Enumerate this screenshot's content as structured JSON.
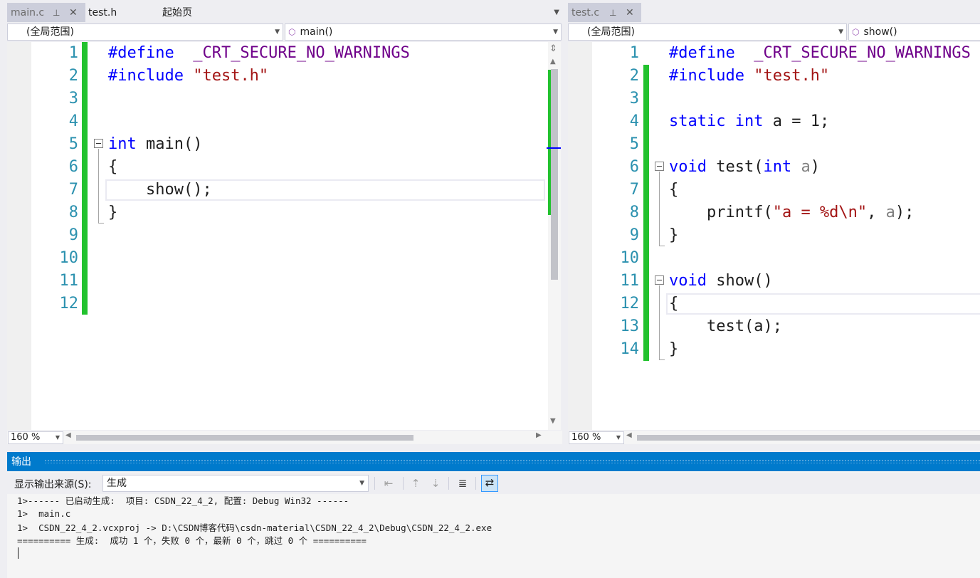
{
  "left_pane": {
    "tabs": [
      {
        "label": "main.c",
        "pin": "⊥",
        "close": "✕"
      },
      {
        "label": "test.h"
      },
      {
        "label": "起始页"
      }
    ],
    "scope": "(全局范围)",
    "function": "main()",
    "zoom": "160 %",
    "lines": [
      "1",
      "2",
      "3",
      "4",
      "5",
      "6",
      "7",
      "8",
      "9",
      "10",
      "11",
      "12"
    ],
    "code": {
      "l1_kw": "#define",
      "l1_macro": "  _CRT_SECURE_NO_WARNINGS",
      "l2_kw": "#include",
      "l2_str": " \"test.h\"",
      "l5_kw": "int",
      "l5_rest": " main()",
      "l6": "{",
      "l7": "    show();",
      "l8": "}"
    }
  },
  "right_pane": {
    "tab": {
      "label": "test.c",
      "pin": "⊥",
      "close": "✕"
    },
    "scope": "(全局范围)",
    "function": "show()",
    "zoom": "160 %",
    "lines": [
      "1",
      "2",
      "3",
      "4",
      "5",
      "6",
      "7",
      "8",
      "9",
      "10",
      "11",
      "12",
      "13",
      "14"
    ],
    "code": {
      "l1_kw": "#define",
      "l1_macro": "  _CRT_SECURE_NO_WARNINGS",
      "l2_kw": "#include",
      "l2_str": " \"test.h\"",
      "l4_kw1": "static",
      "l4_kw2": "int",
      "l4_rest": " a = 1;",
      "l6_kw": "void",
      "l6_mid": " test(",
      "l6_kw2": "int",
      "l6_sp": " ",
      "l6_prm": "a",
      "l6_end": ")",
      "l7": "{",
      "l8_a": "    printf(",
      "l8_str": "\"a = %d\\n\"",
      "l8_b": ", ",
      "l8_prm": "a",
      "l8_c": ");",
      "l9": "}",
      "l11_kw": "void",
      "l11_rest": " show()",
      "l12": "{",
      "l13": "    test(a);",
      "l14": "}"
    }
  },
  "output": {
    "title": "输出",
    "source_label": "显示输出来源(S):",
    "source_value": "生成",
    "lines": [
      "1>------ 已启动生成:  项目: CSDN_22_4_2, 配置: Debug Win32 ------",
      "1>  main.c",
      "1>  CSDN_22_4_2.vcxproj -> D:\\CSDN博客代码\\csdn-material\\CSDN_22_4_2\\Debug\\CSDN_22_4_2.exe",
      "========== 生成:  成功 1 个，失败 0 个，最新 0 个，跳过 0 个 =========="
    ]
  },
  "colors": {
    "accent": "#007acc",
    "change_bar": "#22c22e",
    "keyword": "#0000ff",
    "string": "#a31515",
    "macro": "#6f008a",
    "line_number": "#2b91af"
  }
}
